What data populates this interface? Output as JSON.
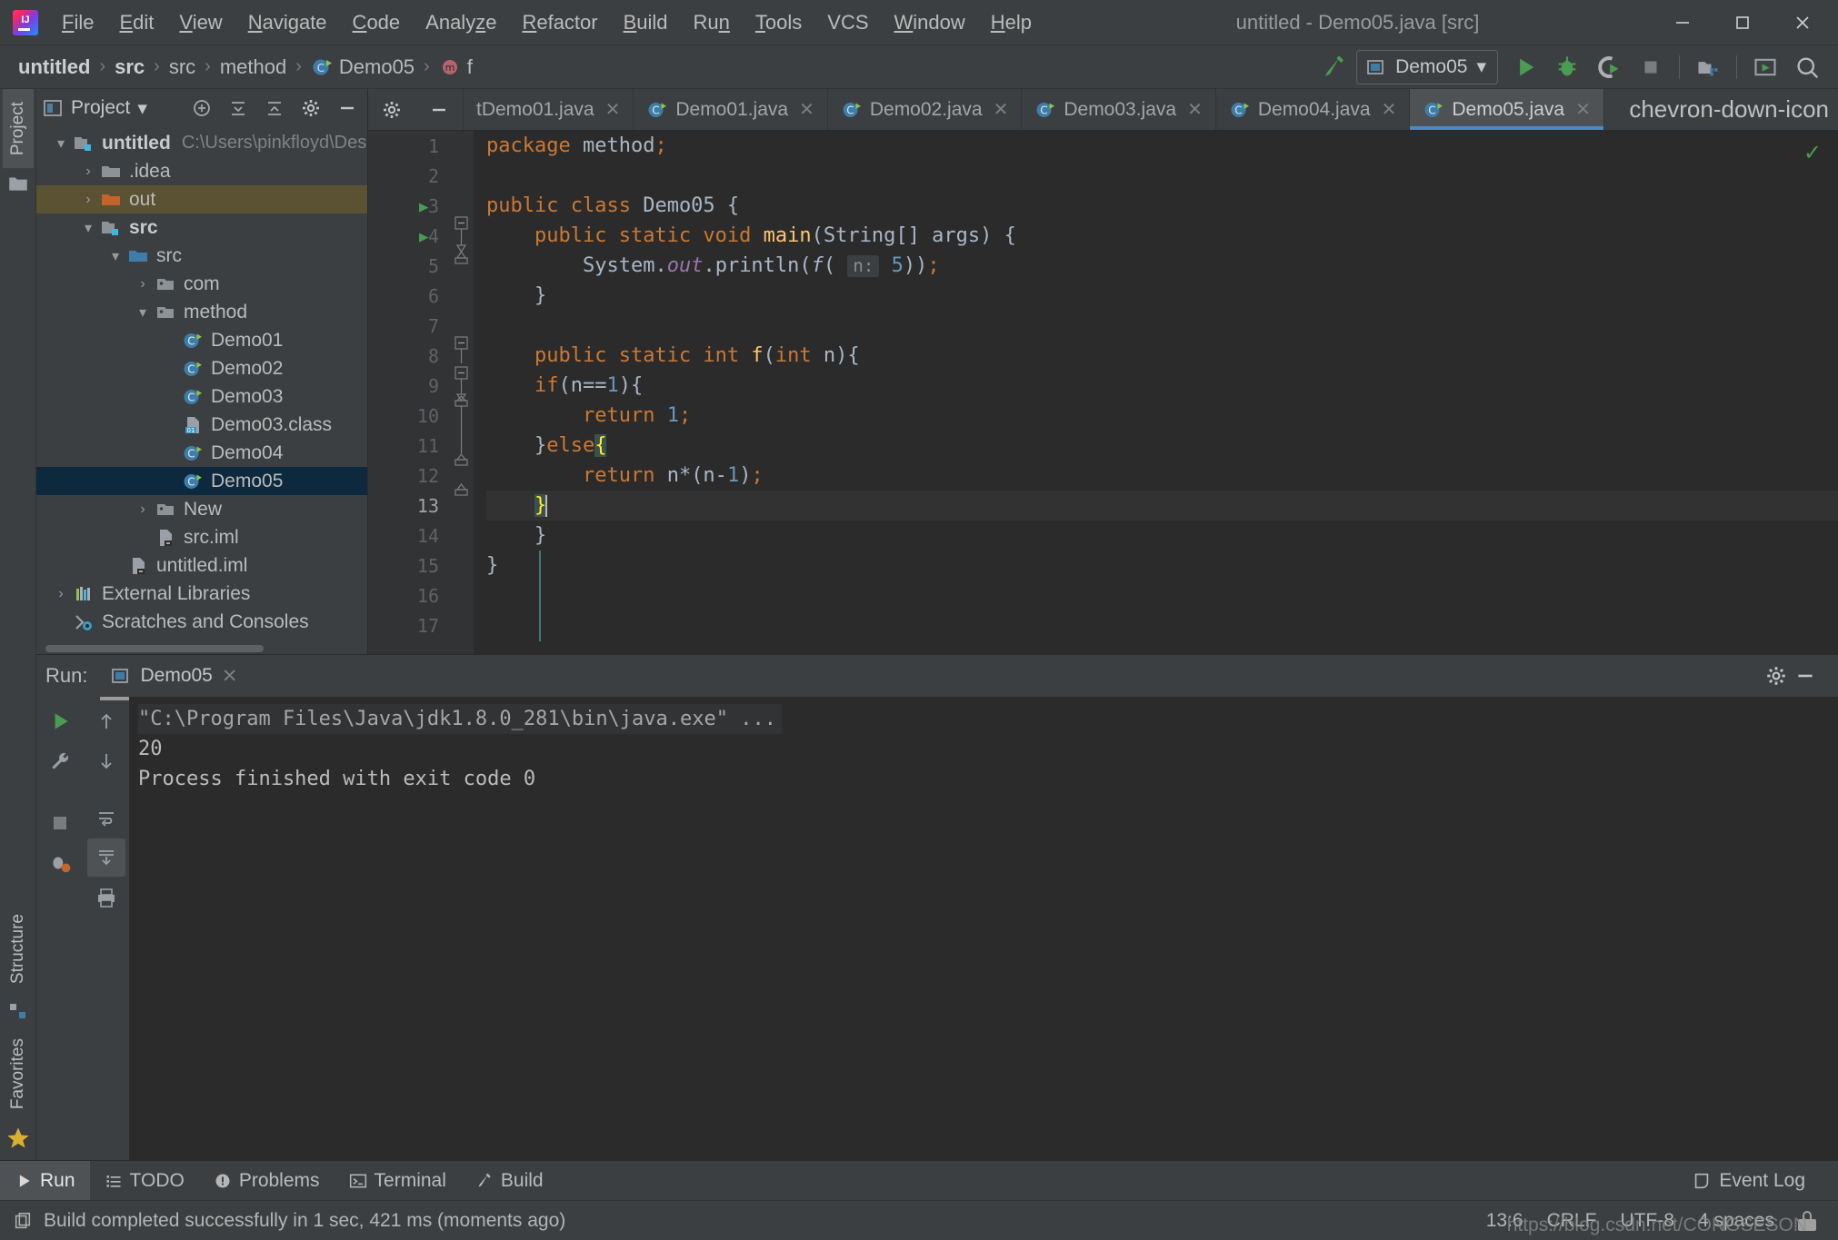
{
  "window": {
    "title": "untitled - Demo05.java [src]",
    "minimize_label": "–",
    "maximize_label": "⬜",
    "close_label": "✕"
  },
  "menubar": {
    "items": [
      {
        "label": "File",
        "mnemonic": "F"
      },
      {
        "label": "Edit",
        "mnemonic": "E"
      },
      {
        "label": "View",
        "mnemonic": "V"
      },
      {
        "label": "Navigate",
        "mnemonic": "N"
      },
      {
        "label": "Code",
        "mnemonic": "C"
      },
      {
        "label": "Analyze",
        "mnemonic": "z"
      },
      {
        "label": "Refactor",
        "mnemonic": "R"
      },
      {
        "label": "Build",
        "mnemonic": "B"
      },
      {
        "label": "Run",
        "mnemonic": "n"
      },
      {
        "label": "Tools",
        "mnemonic": "T"
      },
      {
        "label": "VCS",
        "mnemonic": ""
      },
      {
        "label": "Window",
        "mnemonic": "W"
      },
      {
        "label": "Help",
        "mnemonic": "H"
      }
    ]
  },
  "breadcrumb": {
    "items": [
      {
        "label": "untitled",
        "icon": "",
        "bold": true
      },
      {
        "label": "src",
        "icon": "",
        "bold": true
      },
      {
        "label": "src",
        "icon": "",
        "bold": false
      },
      {
        "label": "method",
        "icon": "",
        "bold": false
      },
      {
        "label": "Demo05",
        "icon": "java-class-icon",
        "bold": false
      },
      {
        "label": "f",
        "icon": "method-icon",
        "bold": false
      }
    ],
    "separator": "›"
  },
  "toolbar": {
    "build_icon": "hammer-icon",
    "run_config_name": "Demo05",
    "run_config_dropdown": "▾",
    "buttons": [
      {
        "name": "run-button",
        "icon": "play-icon"
      },
      {
        "name": "debug-button",
        "icon": "bug-icon"
      },
      {
        "name": "run-coverage-button",
        "icon": "coverage-icon"
      },
      {
        "name": "stop-button",
        "icon": "stop-icon"
      },
      {
        "name": "project-structure-button",
        "icon": "project-structure-icon"
      },
      {
        "name": "open-preview-button",
        "icon": "preview-icon"
      },
      {
        "name": "search-everywhere-button",
        "icon": "search-icon"
      }
    ]
  },
  "left_rail": {
    "project_label": "Project",
    "structure_label": "Structure",
    "favorites_label": "Favorites"
  },
  "project_panel": {
    "title": "Project",
    "dropdown": "▾",
    "header_buttons": [
      "add-icon",
      "expand-all-icon",
      "collapse-all-icon",
      "settings-icon",
      "hide-icon"
    ],
    "tree": [
      {
        "label": "untitled",
        "path": "C:\\Users\\pinkfloyd\\Deskt",
        "indent": 0,
        "arrow": "⌄",
        "icon": "module-folder-icon",
        "bold": true,
        "state": "normal"
      },
      {
        "label": ".idea",
        "path": "",
        "indent": 1,
        "arrow": "›",
        "icon": "folder-icon",
        "bold": false,
        "state": "normal"
      },
      {
        "label": "out",
        "path": "",
        "indent": 1,
        "arrow": "›",
        "icon": "folder-orange-icon",
        "bold": false,
        "state": "highlight-out"
      },
      {
        "label": "src",
        "path": "",
        "indent": 1,
        "arrow": "⌄",
        "icon": "module-folder-icon",
        "bold": true,
        "state": "normal"
      },
      {
        "label": "src",
        "path": "",
        "indent": 2,
        "arrow": "⌄",
        "icon": "source-folder-icon",
        "bold": false,
        "state": "normal"
      },
      {
        "label": "com",
        "path": "",
        "indent": 3,
        "arrow": "›",
        "icon": "package-icon",
        "bold": false,
        "state": "normal"
      },
      {
        "label": "method",
        "path": "",
        "indent": 3,
        "arrow": "⌄",
        "icon": "package-icon",
        "bold": false,
        "state": "normal"
      },
      {
        "label": "Demo01",
        "path": "",
        "indent": 4,
        "arrow": "",
        "icon": "java-class-icon",
        "bold": false,
        "state": "normal"
      },
      {
        "label": "Demo02",
        "path": "",
        "indent": 4,
        "arrow": "",
        "icon": "java-class-icon",
        "bold": false,
        "state": "normal"
      },
      {
        "label": "Demo03",
        "path": "",
        "indent": 4,
        "arrow": "",
        "icon": "java-class-icon",
        "bold": false,
        "state": "normal"
      },
      {
        "label": "Demo03.class",
        "path": "",
        "indent": 4,
        "arrow": "",
        "icon": "class-file-icon",
        "bold": false,
        "state": "normal"
      },
      {
        "label": "Demo04",
        "path": "",
        "indent": 4,
        "arrow": "",
        "icon": "java-class-icon",
        "bold": false,
        "state": "normal"
      },
      {
        "label": "Demo05",
        "path": "",
        "indent": 4,
        "arrow": "",
        "icon": "java-class-icon",
        "bold": false,
        "state": "selected"
      },
      {
        "label": "New",
        "path": "",
        "indent": 3,
        "arrow": "›",
        "icon": "package-icon",
        "bold": false,
        "state": "normal"
      },
      {
        "label": "src.iml",
        "path": "",
        "indent": 3,
        "arrow": "",
        "icon": "iml-file-icon",
        "bold": false,
        "state": "normal"
      },
      {
        "label": "untitled.iml",
        "path": "",
        "indent": 2,
        "arrow": "",
        "icon": "iml-file-icon",
        "bold": false,
        "state": "normal"
      },
      {
        "label": "External Libraries",
        "path": "",
        "indent": 0,
        "arrow": "›",
        "icon": "libraries-icon",
        "bold": false,
        "state": "normal"
      },
      {
        "label": "Scratches and Consoles",
        "path": "",
        "indent": 0,
        "arrow": "",
        "icon": "scratches-icon",
        "bold": false,
        "state": "normal"
      }
    ]
  },
  "editor_tabs": {
    "settings_icon": "gear-icon",
    "hide_icon": "minus-icon",
    "overflow_icon": "chevron-down-icon",
    "tabs": [
      {
        "label": "tDemo01.java",
        "active": false,
        "icon": "none"
      },
      {
        "label": "Demo01.java",
        "active": false,
        "icon": "java-class-icon"
      },
      {
        "label": "Demo02.java",
        "active": false,
        "icon": "java-class-icon"
      },
      {
        "label": "Demo03.java",
        "active": false,
        "icon": "java-class-icon"
      },
      {
        "label": "Demo04.java",
        "active": false,
        "icon": "java-class-icon"
      },
      {
        "label": "Demo05.java",
        "active": true,
        "icon": "java-class-icon"
      }
    ]
  },
  "editor": {
    "line_numbers": [
      1,
      2,
      3,
      4,
      5,
      6,
      7,
      8,
      9,
      10,
      11,
      12,
      13,
      14,
      15,
      16,
      17
    ],
    "current_line": 13,
    "inspection_status": "✓",
    "lines": [
      {
        "n": 1,
        "text": "package method;"
      },
      {
        "n": 2,
        "text": ""
      },
      {
        "n": 3,
        "text": "public class Demo05 {"
      },
      {
        "n": 4,
        "text": "    public static void main(String[] args) {"
      },
      {
        "n": 5,
        "text": "        System.out.println(f( n: 5));"
      },
      {
        "n": 6,
        "text": "    }"
      },
      {
        "n": 7,
        "text": ""
      },
      {
        "n": 8,
        "text": "    public static int f(int n){"
      },
      {
        "n": 9,
        "text": "    if(n==1){"
      },
      {
        "n": 10,
        "text": "        return 1;"
      },
      {
        "n": 11,
        "text": "    }else{"
      },
      {
        "n": 12,
        "text": "        return n*(n-1);"
      },
      {
        "n": 13,
        "text": "    }"
      },
      {
        "n": 14,
        "text": "    }"
      },
      {
        "n": 15,
        "text": "}"
      },
      {
        "n": 16,
        "text": ""
      },
      {
        "n": 17,
        "text": ""
      }
    ],
    "param_hint": "n:"
  },
  "run_panel": {
    "label": "Run:",
    "tab_name": "Demo05",
    "close_icon": "✕",
    "settings_icon": "gear-icon",
    "hide_icon": "minus-icon",
    "toolbar_left": [
      "rerun-icon",
      "wrench-icon",
      "stop-icon",
      "bug-settings-icon"
    ],
    "toolbar_right": [
      "up-arrow-icon",
      "down-arrow-icon",
      "soft-wrap-icon",
      "scroll-to-end-icon",
      "print-icon"
    ],
    "console": [
      {
        "text": "\"C:\\Program Files\\Java\\jdk1.8.0_281\\bin\\java.exe\" ...",
        "style": "cmd"
      },
      {
        "text": "20",
        "style": "out"
      },
      {
        "text": "",
        "style": "out"
      },
      {
        "text": "Process finished with exit code 0",
        "style": "out"
      }
    ]
  },
  "tool_windows": {
    "items": [
      {
        "label": "Run",
        "icon": "play-icon",
        "active": true
      },
      {
        "label": "TODO",
        "icon": "todo-icon",
        "active": false
      },
      {
        "label": "Problems",
        "icon": "problems-icon",
        "active": false
      },
      {
        "label": "Terminal",
        "icon": "terminal-icon",
        "active": false
      },
      {
        "label": "Build",
        "icon": "hammer-icon",
        "active": false
      }
    ],
    "event_log": {
      "label": "Event Log",
      "icon": "event-log-icon"
    }
  },
  "statusbar": {
    "message": "Build completed successfully in 1 sec, 421 ms (moments ago)",
    "message_icon": "copy-icon",
    "caret_position": "13:6",
    "line_separator": "CRLF",
    "encoding": "UTF-8",
    "indent": "4 spaces",
    "lock_icon": "lock-icon",
    "watermark": "https://blog.csdn.net/CONGSESON"
  },
  "colors": {
    "accent_blue": "#4a88c7",
    "keyword_orange": "#cc7832",
    "number_blue": "#6897bb",
    "static_purple": "#9876aa",
    "green_run": "#499c54",
    "selection_blue": "#0d293e",
    "selection_out": "#5b5133",
    "brace_green": "#3b514d",
    "brace_yellow": "#ffef28"
  }
}
